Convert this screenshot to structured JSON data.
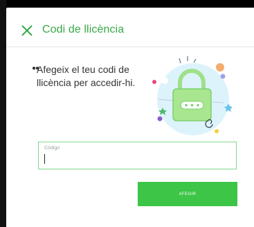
{
  "dialog": {
    "title": "Codi de llicència",
    "description": "Afegeix el teu codi de llicència per accedir-hi.",
    "close_icon": "close-icon",
    "illustration_icon": "padlock-icon"
  },
  "license_field": {
    "label": "Código",
    "value": "",
    "placeholder": ""
  },
  "actions": {
    "add_label": "AFEGIR"
  },
  "colors": {
    "accent": "#38a848",
    "button": "#3cc547",
    "field_border": "#7fd88c"
  }
}
